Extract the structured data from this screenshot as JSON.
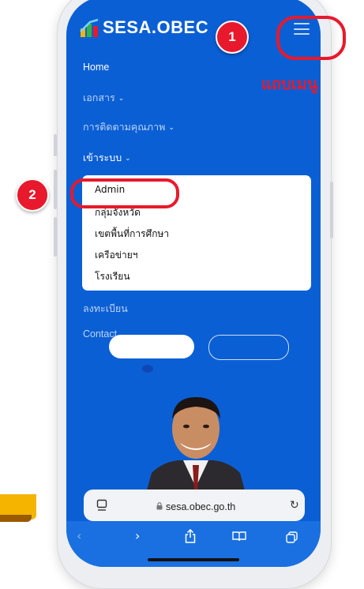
{
  "brand": {
    "name": "SESA.OBEC"
  },
  "nav": {
    "items": [
      {
        "label": "Home",
        "chevron": false,
        "active": true
      },
      {
        "label": "เอกสาร",
        "chevron": true,
        "active": false
      },
      {
        "label": "การติดตามคุณภาพ",
        "chevron": true,
        "active": false
      },
      {
        "label": "เข้าระบบ",
        "chevron": true,
        "active": true
      },
      {
        "label": "ลงทะเบียน",
        "chevron": false,
        "active": false
      },
      {
        "label": "Contact",
        "chevron": false,
        "active": false
      }
    ],
    "login_dropdown": [
      "Admin",
      "กลุ่มจังหวัด",
      "เขตพื้นที่การศึกษา",
      "เครือข่ายฯ",
      "โรงเรียน"
    ]
  },
  "browser": {
    "url": "sesa.obec.go.th"
  },
  "annotations": {
    "step1": "1",
    "step2": "2",
    "menu_label": "แถบเมนู"
  },
  "colors": {
    "screen_blue": "#0b5fd4",
    "callout_red": "#e8192c",
    "white": "#ffffff"
  },
  "icons": [
    "hamburger-icon",
    "lock-icon",
    "tabs-icon",
    "reload-icon",
    "back-icon",
    "forward-icon",
    "share-icon",
    "bookmarks-icon",
    "tab-overview-icon"
  ]
}
